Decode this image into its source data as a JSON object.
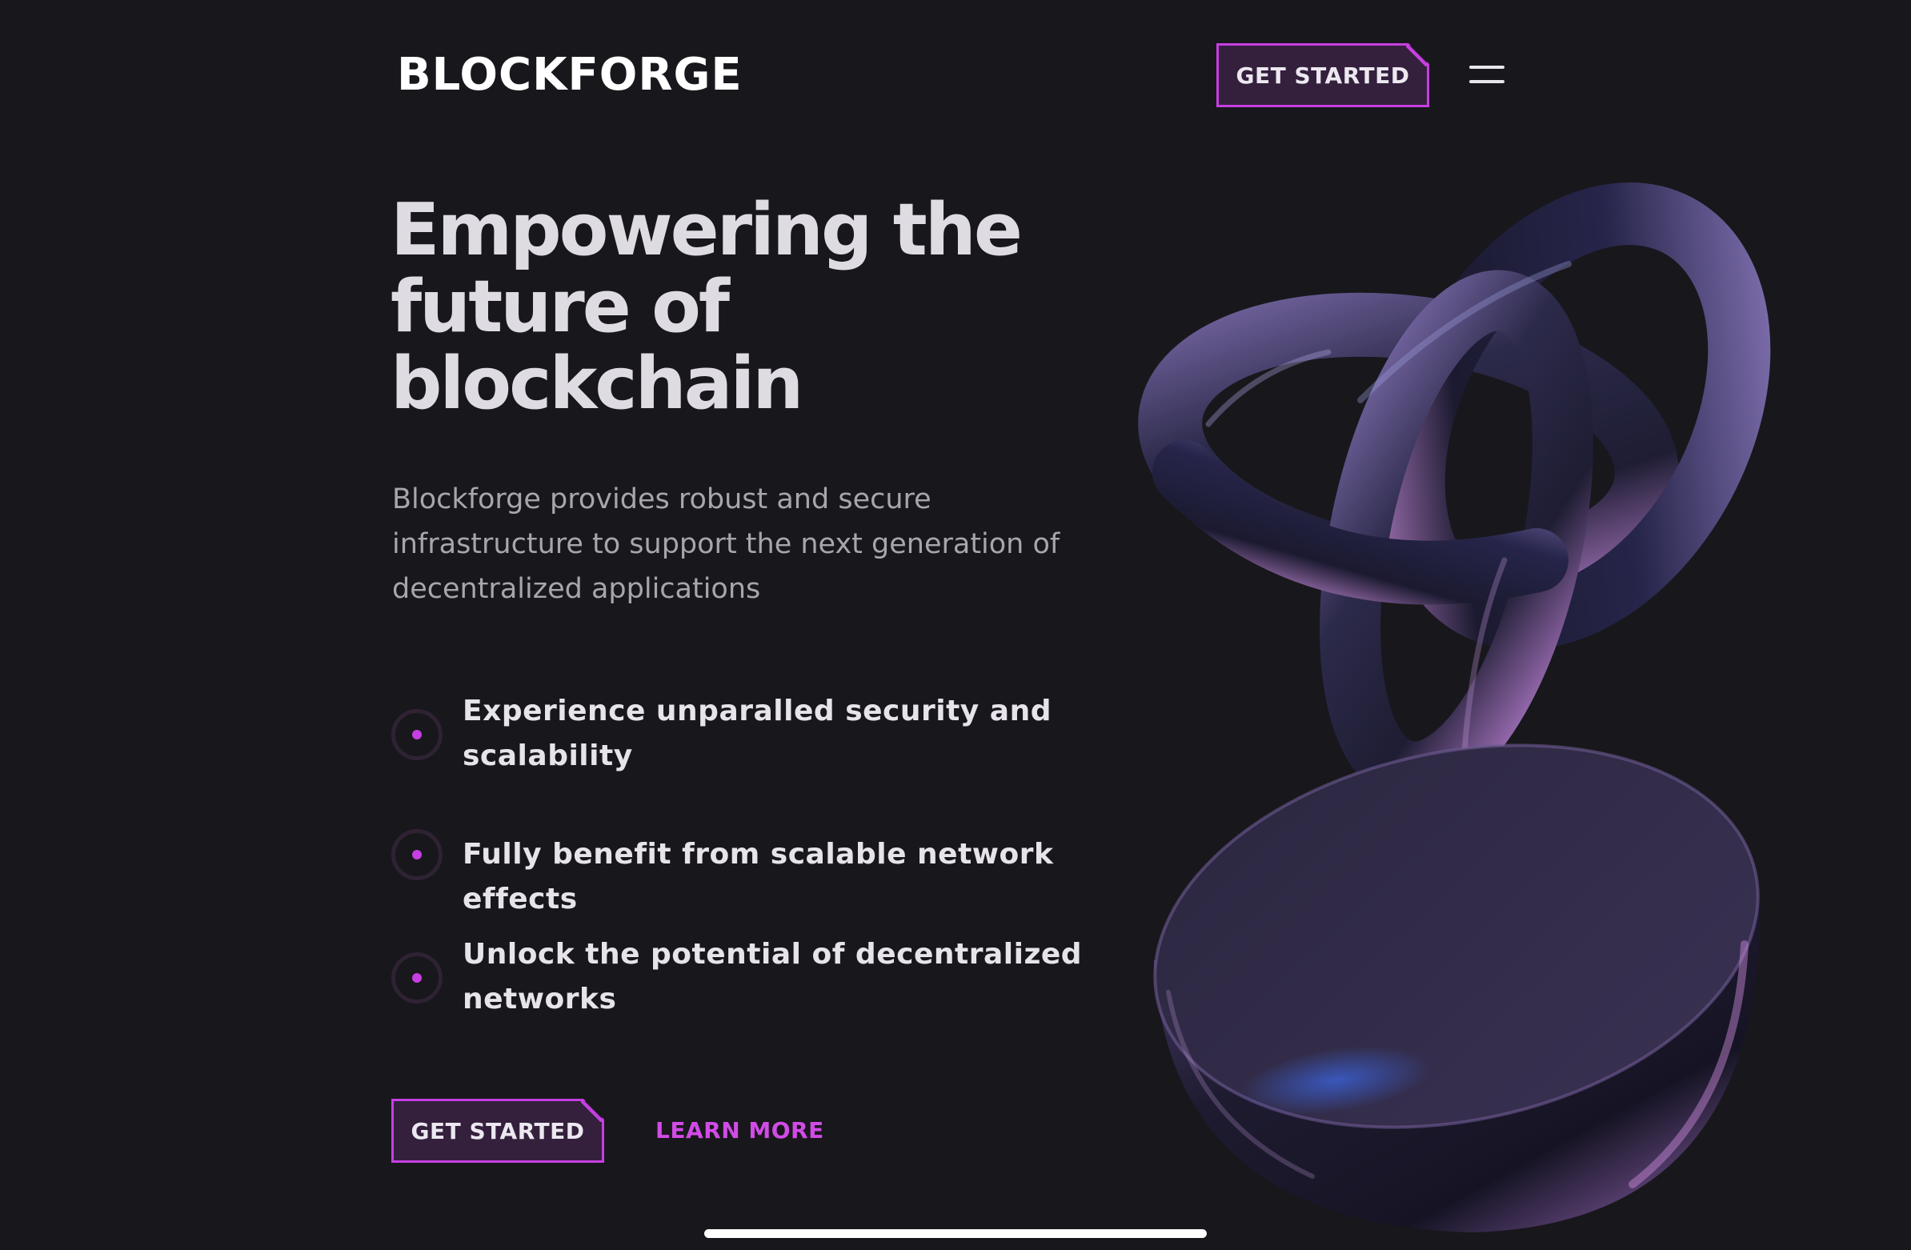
{
  "header": {
    "logo": "BLOCKFORGE",
    "cta_label": "GET STARTED"
  },
  "hero": {
    "title": "Empowering the future of blockchain",
    "description": "Blockforge provides robust and secure infrastructure to support the next generation of decentralized applications"
  },
  "features": [
    {
      "text": "Experience unparalled security and scalability"
    },
    {
      "text": "Fully benefit from scalable network effects"
    },
    {
      "text": "Unlock the potential of decentralized networks"
    }
  ],
  "actions": {
    "primary_label": "GET STARTED",
    "secondary_label": "LEARN MORE"
  },
  "colors": {
    "background": "#18171c",
    "accent": "#c63fe0",
    "button_fill": "#34203d",
    "link": "#d14be6"
  },
  "icons": {
    "menu": "hamburger-menu-icon",
    "bullet": "radio-bullet-icon"
  }
}
